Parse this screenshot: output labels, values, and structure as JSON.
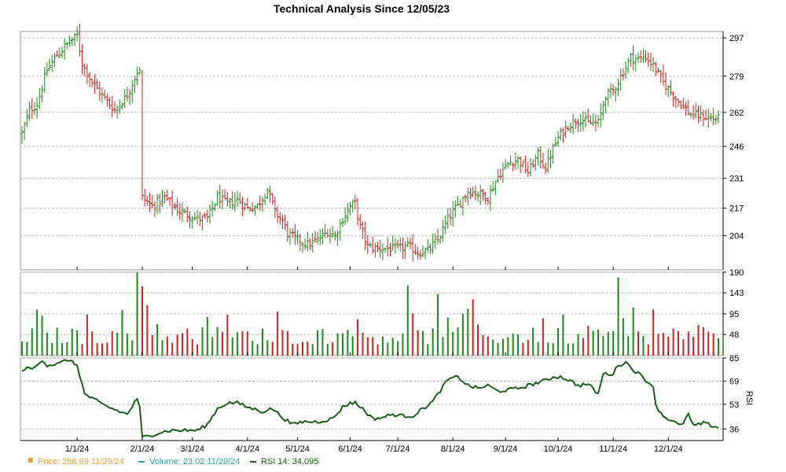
{
  "chart_data": {
    "type": "ohlc",
    "title": "Technical Analysis Since 12/05/23",
    "x_tick_labels": [
      "1/1/24",
      "2/1/24",
      "3/1/24",
      "4/1/24",
      "5/1/24",
      "6/1/24",
      "7/1/24",
      "8/1/24",
      "9/1/24",
      "10/1/24",
      "11/1/24",
      "12/1/24"
    ],
    "panels": {
      "price": {
        "ylim": [
          188,
          300
        ],
        "y_ticks": [
          "297",
          "279",
          "262",
          "246",
          "231",
          "217",
          "204"
        ],
        "close_path": [
          [
            0,
            252
          ],
          [
            3,
            263
          ],
          [
            6,
            266
          ],
          [
            10,
            282
          ],
          [
            14,
            289
          ],
          [
            18,
            294
          ],
          [
            22,
            298
          ],
          [
            24,
            285
          ],
          [
            28,
            276
          ],
          [
            32,
            270
          ],
          [
            37,
            263
          ],
          [
            42,
            270
          ],
          [
            46,
            281
          ],
          [
            47,
            281
          ],
          [
            48,
            222
          ],
          [
            52,
            218
          ],
          [
            57,
            222
          ],
          [
            62,
            216
          ],
          [
            66,
            214
          ],
          [
            70,
            212
          ],
          [
            74,
            212
          ],
          [
            78,
            222
          ],
          [
            82,
            219
          ],
          [
            86,
            221
          ],
          [
            90,
            217
          ],
          [
            94,
            218
          ],
          [
            98,
            226
          ],
          [
            101,
            215
          ],
          [
            104,
            211
          ],
          [
            106,
            205
          ],
          [
            110,
            202
          ],
          [
            114,
            200
          ],
          [
            118,
            202
          ],
          [
            122,
            206
          ],
          [
            125,
            204
          ],
          [
            128,
            212
          ],
          [
            131,
            218
          ],
          [
            133,
            219
          ],
          [
            135,
            208
          ],
          [
            138,
            199
          ],
          [
            142,
            198
          ],
          [
            146,
            198
          ],
          [
            150,
            198
          ],
          [
            154,
            199
          ],
          [
            158,
            196
          ],
          [
            162,
            197
          ],
          [
            166,
            202
          ],
          [
            170,
            212
          ],
          [
            174,
            218
          ],
          [
            178,
            225
          ],
          [
            182,
            224
          ],
          [
            186,
            222
          ],
          [
            190,
            232
          ],
          [
            194,
            238
          ],
          [
            198,
            240
          ],
          [
            202,
            234
          ],
          [
            206,
            242
          ],
          [
            209,
            236
          ],
          [
            211,
            242
          ],
          [
            214,
            250
          ],
          [
            218,
            256
          ],
          [
            221,
            258
          ],
          [
            223,
            259
          ],
          [
            226,
            257
          ],
          [
            230,
            257
          ],
          [
            233,
            270
          ],
          [
            236,
            272
          ],
          [
            240,
            281
          ],
          [
            243,
            288
          ],
          [
            246,
            287
          ],
          [
            249,
            288
          ],
          [
            252,
            284
          ],
          [
            256,
            276
          ],
          [
            260,
            270
          ],
          [
            263,
            266
          ],
          [
            267,
            261
          ],
          [
            272,
            260
          ],
          [
            276,
            259
          ],
          [
            278,
            259
          ]
        ],
        "ohlc_sample": [
          {
            "date": "12/05/23",
            "open": 252,
            "high": 262,
            "low": 251,
            "close": 258
          },
          {
            "date": "1/1/24",
            "open": 292,
            "high": 296,
            "low": 286,
            "close": 290
          },
          {
            "date": "2/1/24",
            "open": 277,
            "high": 281,
            "low": 216,
            "close": 221
          },
          {
            "date": "3/1/24",
            "open": 215,
            "high": 218,
            "low": 200,
            "close": 212
          },
          {
            "date": "6/1/24",
            "open": 200,
            "high": 212,
            "low": 197,
            "close": 206
          },
          {
            "date": "7/1/24",
            "open": 196,
            "high": 198,
            "low": 194,
            "close": 197
          },
          {
            "date": "10/1/24",
            "open": 255,
            "high": 260,
            "low": 253,
            "close": 256
          },
          {
            "date": "10/24/24",
            "open": 289,
            "high": 296,
            "low": 287,
            "close": 292
          },
          {
            "date": "11/29/24",
            "open": 260,
            "high": 262,
            "low": 258,
            "close": 258.69
          }
        ]
      },
      "volume": {
        "ylim": [
          0,
          190
        ],
        "y_ticks": [
          "190",
          "143",
          "95",
          "48"
        ],
        "last": 23.02
      },
      "rsi": {
        "ylim": [
          28,
          85
        ],
        "y_ticks": [
          "85",
          "69",
          "53",
          "36"
        ],
        "ylabel": "RSI",
        "path": [
          [
            0,
            77
          ],
          [
            5,
            78
          ],
          [
            8,
            84
          ],
          [
            10,
            80
          ],
          [
            15,
            81
          ],
          [
            18,
            84
          ],
          [
            22,
            80
          ],
          [
            25,
            60
          ],
          [
            28,
            57
          ],
          [
            32,
            53
          ],
          [
            36,
            50
          ],
          [
            42,
            46
          ],
          [
            46,
            57
          ],
          [
            47,
            50
          ],
          [
            48,
            30
          ],
          [
            52,
            32
          ],
          [
            56,
            34
          ],
          [
            60,
            35
          ],
          [
            66,
            35
          ],
          [
            70,
            35
          ],
          [
            74,
            39
          ],
          [
            78,
            50
          ],
          [
            82,
            54
          ],
          [
            86,
            54
          ],
          [
            90,
            51
          ],
          [
            96,
            48
          ],
          [
            100,
            50
          ],
          [
            104,
            44
          ],
          [
            108,
            39
          ],
          [
            112,
            41
          ],
          [
            118,
            41
          ],
          [
            124,
            43
          ],
          [
            128,
            51
          ],
          [
            131,
            54
          ],
          [
            133,
            54
          ],
          [
            136,
            50
          ],
          [
            140,
            43
          ],
          [
            144,
            44
          ],
          [
            148,
            46
          ],
          [
            152,
            45
          ],
          [
            156,
            45
          ],
          [
            160,
            50
          ],
          [
            164,
            55
          ],
          [
            166,
            60
          ],
          [
            170,
            70
          ],
          [
            174,
            72
          ],
          [
            178,
            66
          ],
          [
            182,
            64
          ],
          [
            186,
            66
          ],
          [
            190,
            62
          ],
          [
            194,
            63
          ],
          [
            198,
            64
          ],
          [
            202,
            66
          ],
          [
            206,
            68
          ],
          [
            210,
            70
          ],
          [
            212,
            72
          ],
          [
            215,
            72
          ],
          [
            218,
            70
          ],
          [
            222,
            66
          ],
          [
            226,
            67
          ],
          [
            230,
            60
          ],
          [
            232,
            74
          ],
          [
            236,
            74
          ],
          [
            238,
            80
          ],
          [
            241,
            82
          ],
          [
            244,
            77
          ],
          [
            247,
            73
          ],
          [
            250,
            68
          ],
          [
            252,
            66
          ],
          [
            253,
            52
          ],
          [
            256,
            45
          ],
          [
            260,
            41
          ],
          [
            263,
            38
          ],
          [
            266,
            46
          ],
          [
            268,
            38
          ],
          [
            272,
            40
          ],
          [
            276,
            38
          ],
          [
            278,
            37
          ]
        ]
      }
    }
  },
  "legend": {
    "price_label": "Price: 258.69  11/29/24",
    "volume_label": "Volume: 23.02  11/29/24",
    "rsi_label": "RSI 14: 34.095"
  },
  "colors": {
    "up": "#1e8a1e",
    "down": "#cc2222",
    "rsi_line": "#1a5c1a",
    "price_legend": "#e8a33a",
    "volume_legend": "#2aa3a3",
    "axis_label": "#1a3a8a"
  }
}
